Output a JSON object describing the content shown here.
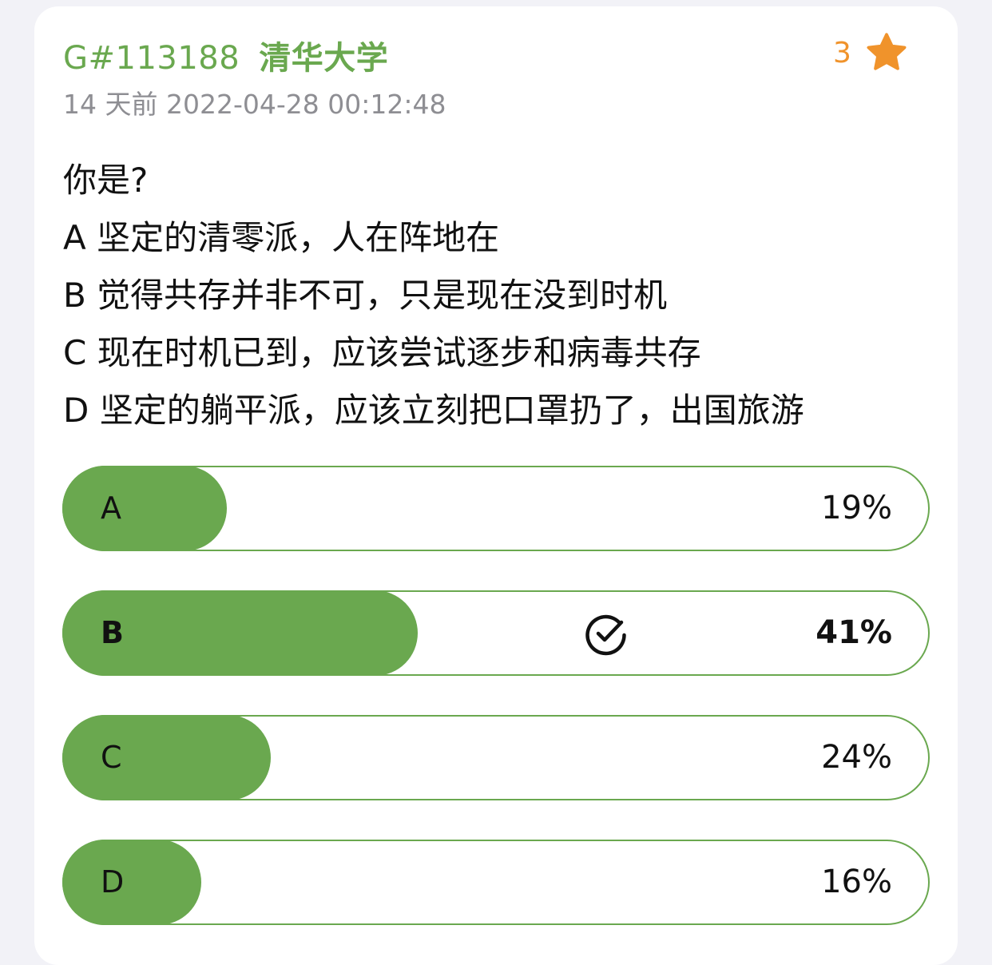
{
  "post": {
    "id": "G#113188",
    "school": "清华大学",
    "time": "14 天前 2022-04-28 00:12:48",
    "star_count": "3",
    "star_icon": "star-icon",
    "content_lines": [
      "你是?",
      "A  坚定的清零派，人在阵地在",
      "B  觉得共存并非不可，只是现在没到时机",
      "C  现在时机已到，应该尝试逐步和病毒共存",
      "D  坚定的躺平派，应该立刻把口罩扔了，出国旅游"
    ]
  },
  "colors": {
    "accent_green": "#6aa84f",
    "star_orange": "#f0932b",
    "muted_gray": "#8e8e93"
  },
  "poll": {
    "options": [
      {
        "label": "A",
        "percent_text": "19%",
        "fraction": 0.19,
        "selected": false
      },
      {
        "label": "B",
        "percent_text": "41%",
        "fraction": 0.41,
        "selected": true,
        "selected_icon": "check-circle-icon"
      },
      {
        "label": "C",
        "percent_text": "24%",
        "fraction": 0.24,
        "selected": false
      },
      {
        "label": "D",
        "percent_text": "16%",
        "fraction": 0.16,
        "selected": false
      }
    ]
  }
}
